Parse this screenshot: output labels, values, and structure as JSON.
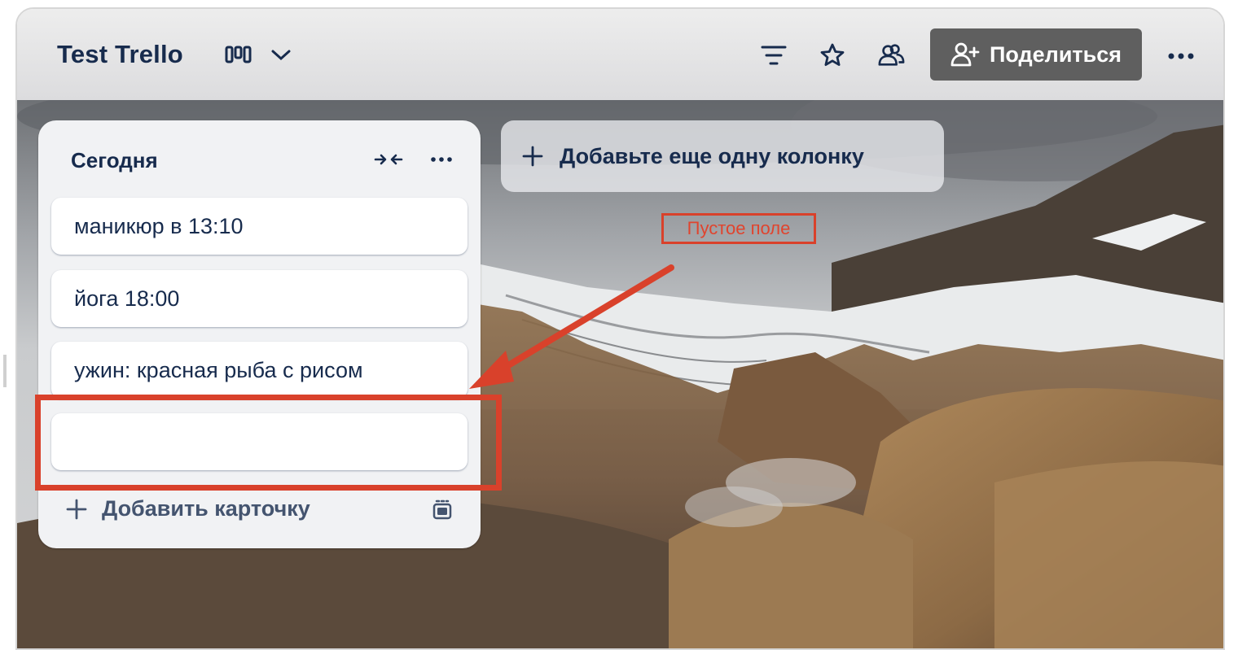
{
  "board": {
    "title": "Test Trello",
    "view_icon": "board-view-icon",
    "share_label": "Поделиться"
  },
  "header_icons": [
    "filter-icon",
    "star-icon",
    "members-icon",
    "more-icon"
  ],
  "list": {
    "title": "Сегодня",
    "cards": [
      {
        "text": "маникюр в 13:10"
      },
      {
        "text": "йога 18:00"
      },
      {
        "text": "ужин: красная рыба с рисом"
      },
      {
        "text": ""
      }
    ],
    "add_card_label": "Добавить карточку"
  },
  "add_column_label": "Добавьте еще одну колонку",
  "annotation": {
    "label": "Пустое поле",
    "color": "#d9412b"
  }
}
